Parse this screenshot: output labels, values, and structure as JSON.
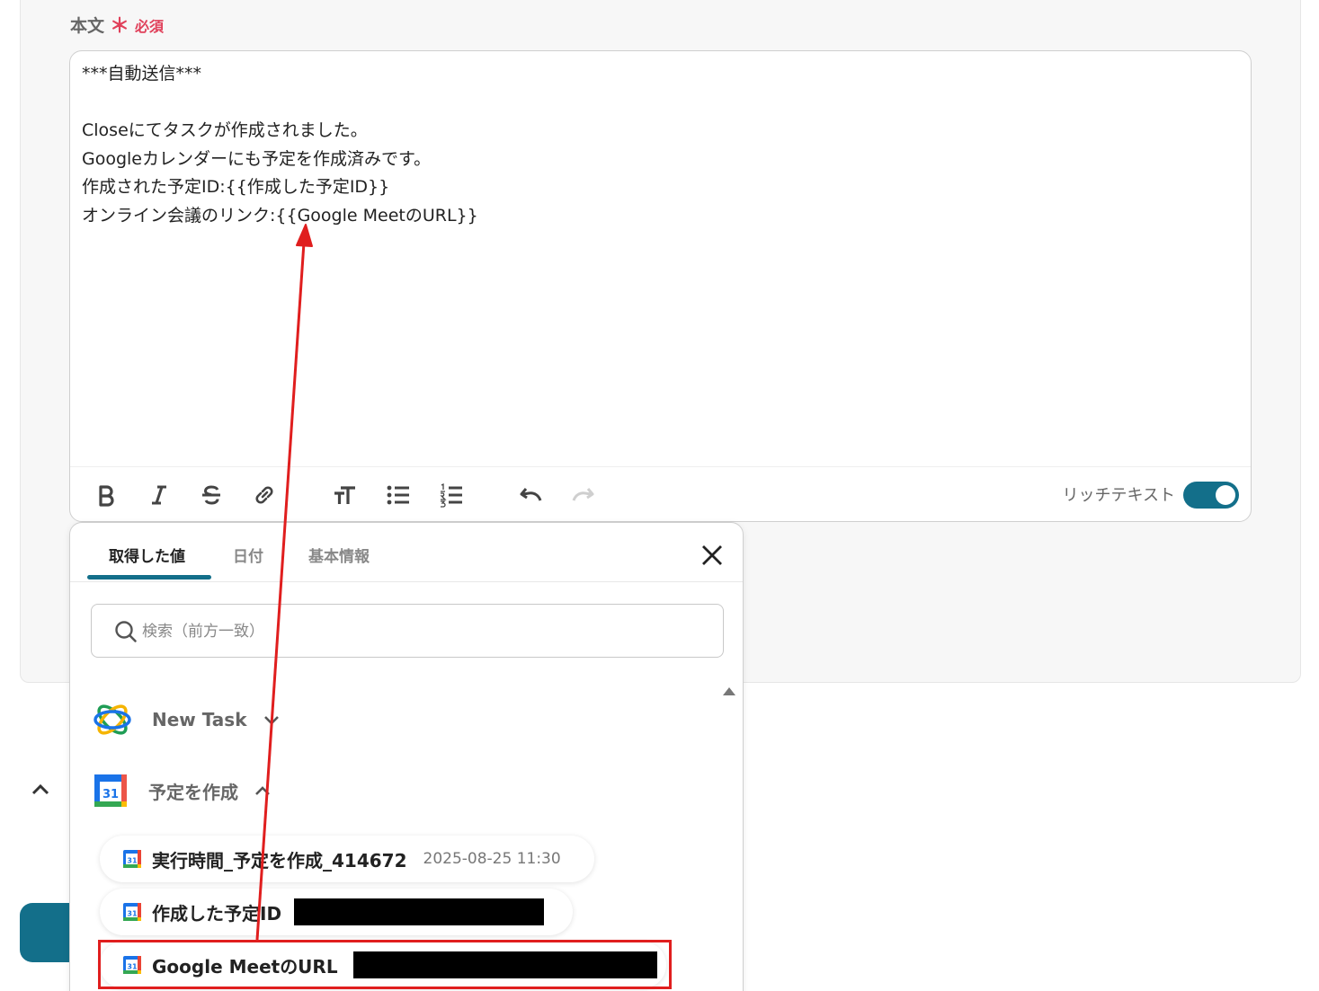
{
  "field": {
    "label": "本文",
    "required_mark": "＊",
    "required_text": "必須"
  },
  "editor": {
    "lines": [
      "***自動送信***",
      "",
      "Closeにてタスクが作成されました。",
      "Googleカレンダーにも予定を作成済みです。",
      "作成された予定ID:{{作成した予定ID}}",
      "オンライン会議のリンク:{{Google MeetのURL}}"
    ],
    "toolbar": {
      "rich_text_label": "リッチテキスト",
      "rich_text_enabled": true,
      "buttons": [
        "bold-icon",
        "italic-icon",
        "strikethrough-icon",
        "link-icon",
        "text-size-icon",
        "bullet-list-icon",
        "numbered-list-icon",
        "undo-icon",
        "redo-icon"
      ]
    }
  },
  "popup": {
    "tabs": [
      "取得した値",
      "日付",
      "基本情報"
    ],
    "active_tab": 0,
    "search_placeholder": "検索（前方一致）",
    "groups": [
      {
        "name": "New Task",
        "icon": "close-crm-icon",
        "expanded": false
      },
      {
        "name": "予定を作成",
        "icon": "google-calendar-icon",
        "expanded": true
      }
    ],
    "items": [
      {
        "name": "実行時間_予定を作成_414672",
        "value": "2025-08-25 11:30",
        "redacted": false
      },
      {
        "name": "作成した予定ID",
        "value": "",
        "redacted": true
      },
      {
        "name": "Google MeetのURL",
        "value": "",
        "redacted": true,
        "highlighted": true
      }
    ]
  },
  "colors": {
    "accent": "#136f8a",
    "required": "#e0405a",
    "annotation": "#e01e1e"
  }
}
